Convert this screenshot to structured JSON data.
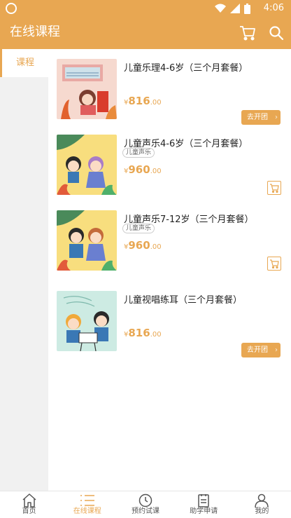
{
  "status_bar": {
    "time": "4:06"
  },
  "app_bar": {
    "title": "在线课程",
    "cart_icon": "cart-icon",
    "search_icon": "search-icon"
  },
  "sidebar": {
    "items": [
      {
        "label": "课程",
        "active": true
      }
    ]
  },
  "courses": [
    {
      "name": "儿童乐理4-6岁（三个月套餐）",
      "tag": "",
      "price_symbol": "¥",
      "price_int": "816",
      "price_dec": ".00",
      "action": "去开团"
    },
    {
      "name": "儿童声乐4-6岁（三个月套餐）",
      "tag": "儿童声乐",
      "price_symbol": "¥",
      "price_int": "960",
      "price_dec": ".00",
      "action": "cart"
    },
    {
      "name": "儿童声乐7-12岁（三个月套餐）",
      "tag": "儿童声乐",
      "price_symbol": "¥",
      "price_int": "960",
      "price_dec": ".00",
      "action": "cart"
    },
    {
      "name": "儿童视唱练耳（三个月套餐）",
      "tag": "",
      "price_symbol": "¥",
      "price_int": "816",
      "price_dec": ".00",
      "action": "去开团"
    }
  ],
  "bottom_nav": {
    "items": [
      {
        "label": "首页",
        "icon": "home-icon"
      },
      {
        "label": "在线课程",
        "icon": "list-icon",
        "active": true
      },
      {
        "label": "预约试课",
        "icon": "clock-icon"
      },
      {
        "label": "助学申请",
        "icon": "clipboard-icon"
      },
      {
        "label": "我的",
        "icon": "person-icon"
      }
    ]
  },
  "colors": {
    "accent": "#e8a752",
    "sidebar_bg": "#f1f1f1",
    "text": "#222222"
  }
}
